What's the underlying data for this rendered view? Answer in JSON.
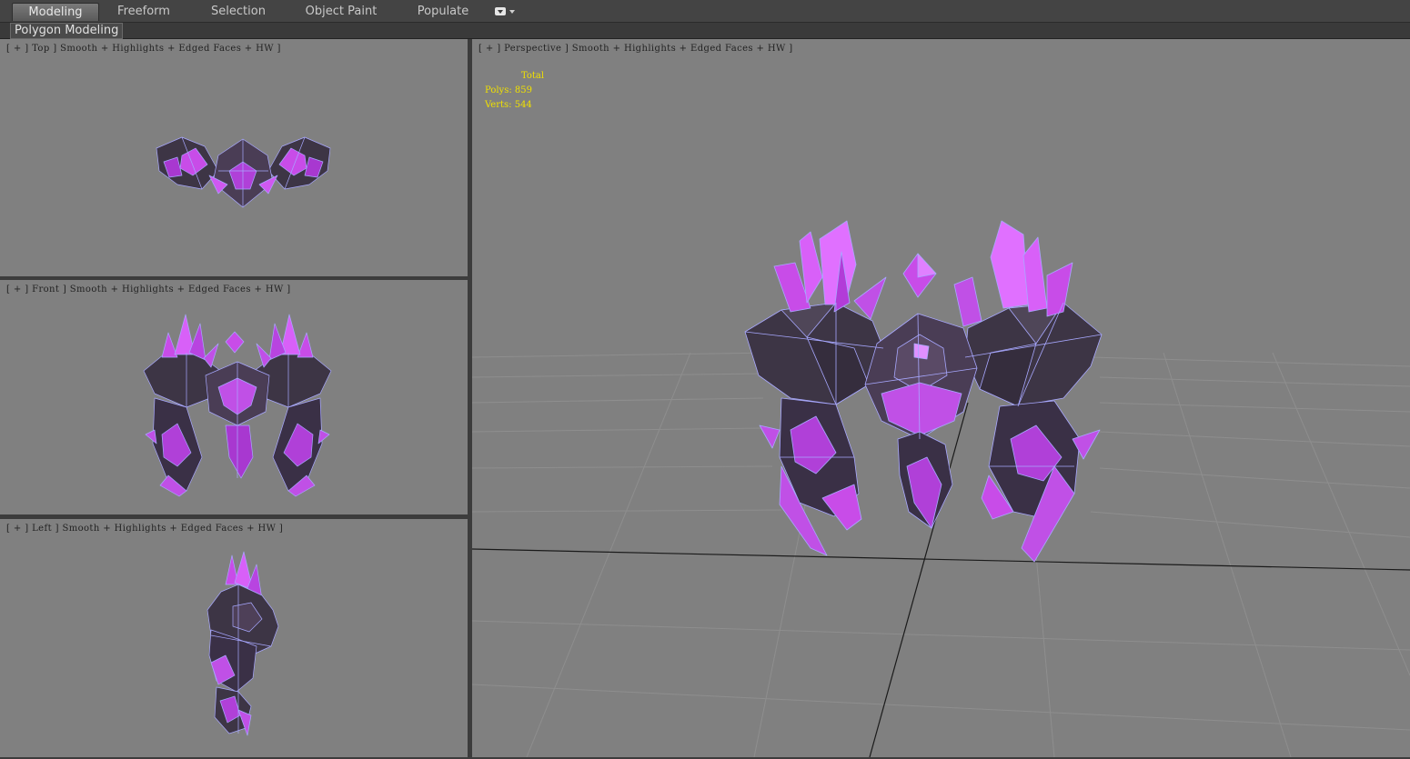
{
  "ribbon": {
    "tabs": [
      "Modeling",
      "Freeform",
      "Selection",
      "Object Paint",
      "Populate"
    ],
    "active_tab": "Modeling",
    "panel_label": "Polygon Modeling"
  },
  "viewports": {
    "top": {
      "label": "[ + ] Top ] Smooth + Highlights + Edged Faces + HW ]"
    },
    "front": {
      "label": "[ + ] Front ] Smooth + Highlights + Edged Faces + HW ]"
    },
    "left": {
      "label": "[ + ] Left ] Smooth + Highlights + Edged Faces + HW ]"
    },
    "perspective": {
      "label": "[ + ] Perspective ] Smooth + Highlights + Edged Faces + HW ]",
      "stats": {
        "header": "Total",
        "polys": "Polys: 859",
        "verts": "Verts: 544"
      }
    }
  },
  "colors": {
    "viewport_bg": "#808080",
    "crystal": "#c040e0",
    "rock": "#3a3440",
    "wire": "#a8a8ff",
    "stats_text": "#f0e000"
  },
  "icons": [
    "dropdown-icon"
  ]
}
